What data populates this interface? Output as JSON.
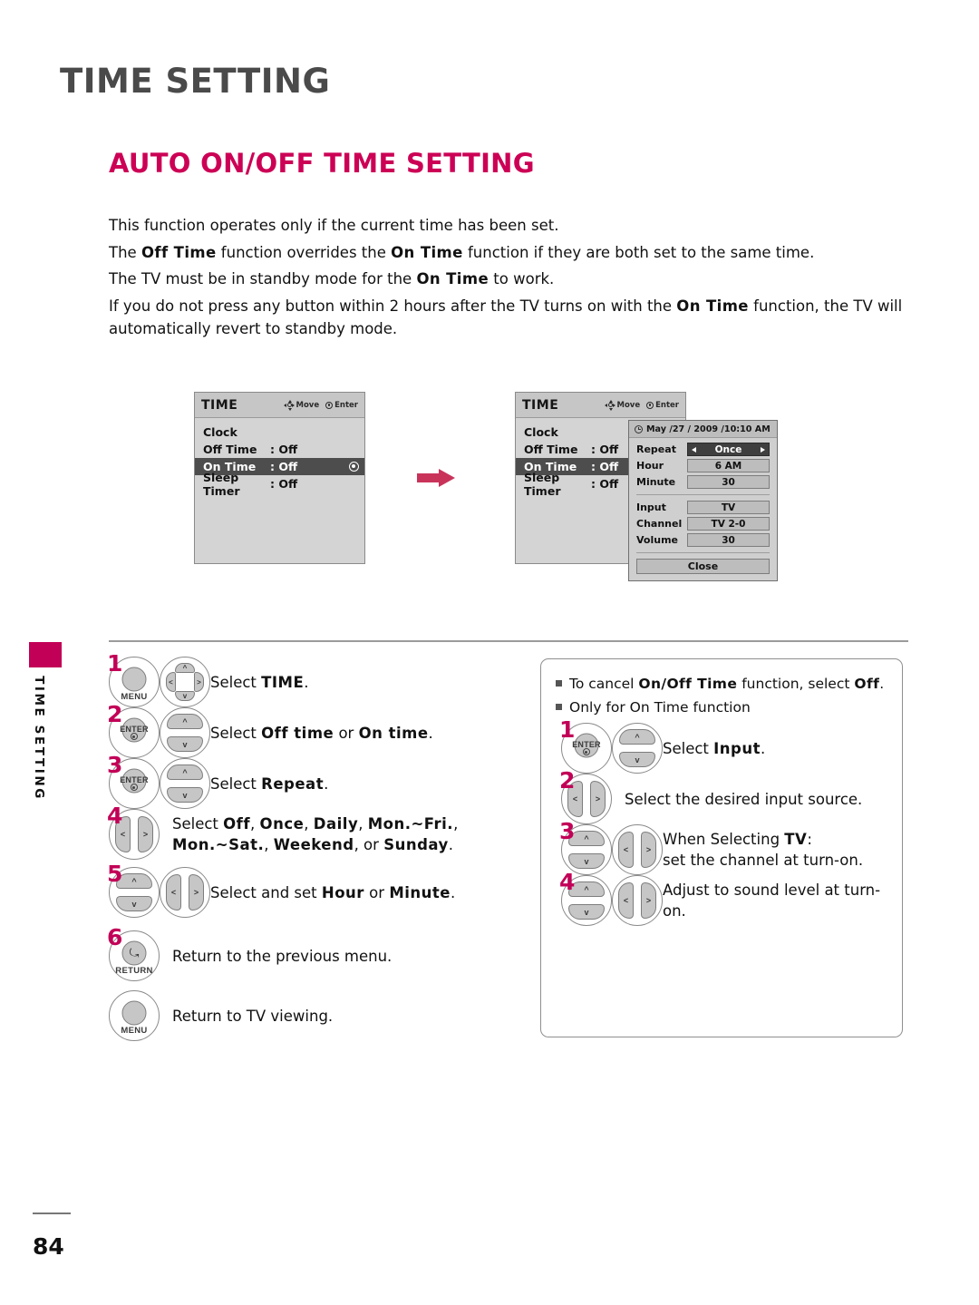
{
  "page": {
    "title": "TIME SETTING",
    "section_title": "AUTO ON/OFF TIME SETTING",
    "side_tab": "TIME SETTING",
    "page_number": "84",
    "accent_color": "#c20057",
    "heading_color": "#4a4a4a"
  },
  "intro": {
    "l1": "This function operates only if the current time has been set.",
    "l2a": "The ",
    "l2b": "Off Time",
    "l2c": " function overrides the ",
    "l2d": "On Time",
    "l2e": " function if they are both set to the same time.",
    "l3a": "The TV must be in standby mode for the ",
    "l3b": "On Time",
    "l3c": " to work.",
    "l4a": "If you do not press any button within 2 hours after the TV turns on with the ",
    "l4b": "On Time",
    "l4c": " function, the TV will automatically revert to standby mode."
  },
  "osd": {
    "header_title": "TIME",
    "hint_move": "Move",
    "hint_enter": "Enter",
    "rows": [
      {
        "label": "Clock",
        "value": ""
      },
      {
        "label": "Off Time",
        "value": ": Off"
      },
      {
        "label": "On Time",
        "value": ": Off"
      },
      {
        "label": "Sleep Timer",
        "value": ": Off"
      }
    ]
  },
  "detail": {
    "datetime": "May /27 / 2009 /10:10 AM",
    "fields": [
      {
        "label": "Repeat",
        "value": "Once"
      },
      {
        "label": "Hour",
        "value": "6 AM"
      },
      {
        "label": "Minute",
        "value": "30"
      },
      {
        "label": "Input",
        "value": "TV"
      },
      {
        "label": "Channel",
        "value": "TV 2-0"
      },
      {
        "label": "Volume",
        "value": "30"
      }
    ],
    "close_label": "Close"
  },
  "steps_left": [
    {
      "num": "1",
      "buttons": [
        "menu-button",
        "four-way-navigation-pad"
      ],
      "text_a": "Select ",
      "text_b": "TIME",
      "text_c": "."
    },
    {
      "num": "2",
      "buttons": [
        "enter-button",
        "up-down-pad"
      ],
      "text_a": "Select ",
      "text_b": "Off time",
      "text_c": " or ",
      "text_d": "On time",
      "text_e": "."
    },
    {
      "num": "3",
      "buttons": [
        "enter-button",
        "up-down-pad"
      ],
      "text_a": "Select ",
      "text_b": "Repeat",
      "text_c": "."
    },
    {
      "num": "4",
      "buttons": [
        "left-right-pad"
      ],
      "text_a": "Select ",
      "text_b": "Off",
      "text_c": ", ",
      "text_d": "Once",
      "text_e": ", ",
      "text_f": "Daily",
      "text_g": ", ",
      "text_h": "Mon.~Fri.",
      "text_i": ", ",
      "text_j": "Mon.~Sat.",
      "text_k": ", ",
      "text_l": "Weekend",
      "text_m": ", or ",
      "text_n": "Sunday",
      "text_o": "."
    },
    {
      "num": "5",
      "buttons": [
        "up-down-pad",
        "left-right-pad"
      ],
      "text_a": "Select and set ",
      "text_b": "Hour",
      "text_c": " or ",
      "text_d": "Minute",
      "text_e": "."
    },
    {
      "num": "6",
      "buttons": [
        "return-button"
      ],
      "text_a": "Return to the previous menu."
    },
    {
      "num": "",
      "buttons": [
        "menu-button"
      ],
      "text_a": "Return to TV viewing."
    }
  ],
  "button_labels": {
    "menu": "MENU",
    "enter": "ENTER",
    "return": "RETURN"
  },
  "panel": {
    "note1_a": "To cancel ",
    "note1_b": "On/Off Time",
    "note1_c": " function, select ",
    "note1_d": "Off",
    "note1_e": ".",
    "note2": "Only for On Time function",
    "steps": [
      {
        "num": "1",
        "buttons": [
          "enter-button",
          "up-down-pad"
        ],
        "text_a": "Select ",
        "text_b": "Input",
        "text_c": "."
      },
      {
        "num": "2",
        "buttons": [
          "left-right-pad"
        ],
        "text_a": "Select the desired input source."
      },
      {
        "num": "3",
        "buttons": [
          "up-down-pad",
          "left-right-pad"
        ],
        "text_a": "When Selecting ",
        "text_b": "TV",
        "text_c": ":",
        "text_d": "set the channel at turn-on."
      },
      {
        "num": "4",
        "buttons": [
          "up-down-pad",
          "left-right-pad"
        ],
        "text_a": "Adjust to sound level at turn-on."
      }
    ]
  }
}
